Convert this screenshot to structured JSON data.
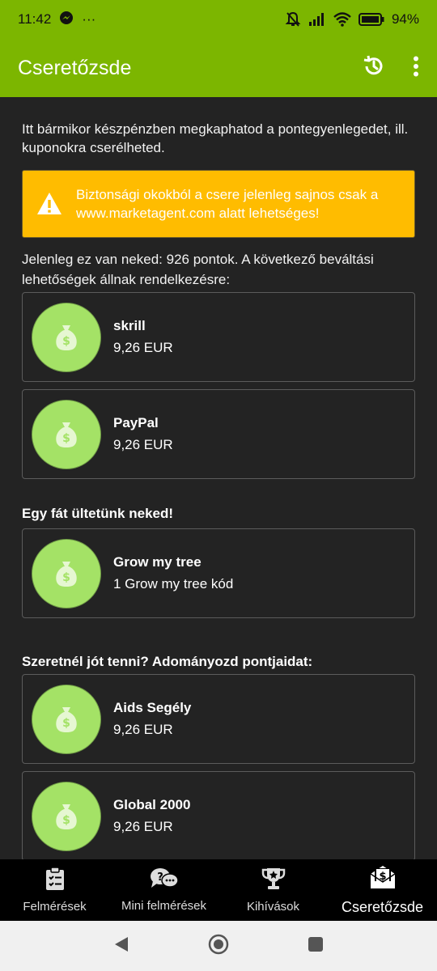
{
  "status_bar": {
    "time": "11:42",
    "more_dots": "···",
    "battery": "94%"
  },
  "app_bar": {
    "title": "Cseretőzsde",
    "history_icon": "history-icon",
    "menu_icon": "more-vert-icon"
  },
  "main": {
    "intro": "Itt bármikor készpénzben megkaphatod a pontegyenlegedet, ill. kuponokra cserélheted.",
    "warning": "Biztonsági okokból a csere jelenleg sajnos csak a www.marketagent.com alatt lehetséges!",
    "balance_prefix": "Jelenleg ez van neked: ",
    "balance_points": "926 pontok",
    "balance_suffix": ". A következő beváltási lehetőségek állnak rendelkezésre:",
    "payout_options": [
      {
        "name": "skrill",
        "value": "9,26 EUR"
      },
      {
        "name": "PayPal",
        "value": "9,26 EUR"
      }
    ],
    "tree_section_title": "Egy fát ültetünk neked!",
    "tree_option": {
      "name": "Grow my tree",
      "value": "1 Grow my tree kód"
    },
    "donation_section_title": "Szeretnél jót tenni? Adományozd pontjaidat:",
    "donation_options": [
      {
        "name": "Aids Segély",
        "value": "9,26 EUR"
      },
      {
        "name": "Global 2000",
        "value": "9,26 EUR"
      }
    ]
  },
  "bottom_nav": {
    "items": [
      {
        "label": "Felmérések",
        "icon": "clipboard-checklist-icon"
      },
      {
        "label": "Mini felmérések",
        "icon": "chat-question-icon"
      },
      {
        "label": "Kihívások",
        "icon": "trophy-icon"
      },
      {
        "label": "Cseretőzsde",
        "icon": "money-envelope-icon"
      }
    ],
    "active_index": 3
  },
  "colors": {
    "app_bar": "#7cb600",
    "background": "#232323",
    "warning": "#ffbc00",
    "bubble": "#a4e266"
  }
}
